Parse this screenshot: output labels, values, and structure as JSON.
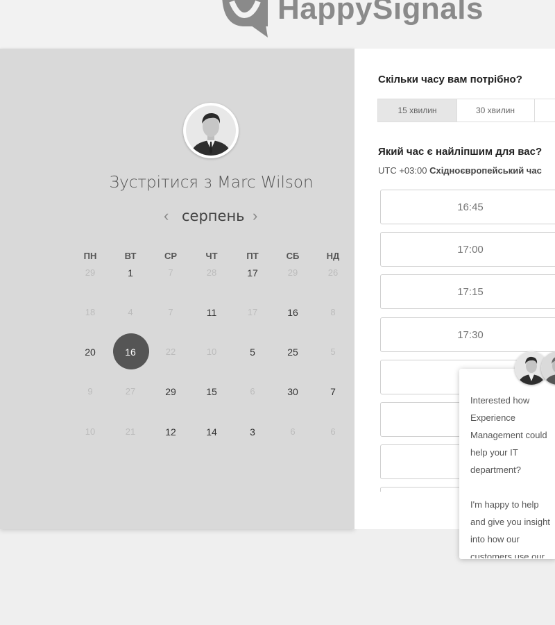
{
  "header": {
    "logo_text": "HappySignals"
  },
  "calendar": {
    "title": "Зустрітися з Marc Wilson",
    "month": "серпень",
    "weekdays": [
      "ПН",
      "ВТ",
      "СР",
      "ЧТ",
      "ПТ",
      "СБ",
      "НД"
    ],
    "weeks": [
      [
        "29",
        "1",
        "7",
        "28",
        "17",
        "29",
        "26"
      ],
      [
        "18",
        "4",
        "7",
        "11",
        "17",
        "16",
        "8"
      ],
      [
        "20",
        "16",
        "22",
        "10",
        "5",
        "25",
        "5"
      ],
      [
        "9",
        "27",
        "29",
        "15",
        "6",
        "30",
        "7"
      ],
      [
        "10",
        "21",
        "12",
        "14",
        "3",
        "6",
        "6"
      ]
    ],
    "available": [
      [
        false,
        true,
        false,
        false,
        true,
        false,
        false
      ],
      [
        false,
        false,
        false,
        true,
        false,
        true,
        false
      ],
      [
        true,
        true,
        false,
        false,
        true,
        true,
        false
      ],
      [
        false,
        false,
        true,
        true,
        false,
        true,
        true
      ],
      [
        false,
        false,
        true,
        true,
        true,
        false,
        false
      ]
    ],
    "selected_day": "16"
  },
  "booking": {
    "duration_question": "Скільки часу вам потрібно?",
    "durations": [
      "15 хвилин",
      "30 хвилин",
      ""
    ],
    "time_question": "Який час є найліпшим для вас?",
    "tz_offset": "UTC +03:00",
    "tz_name": "Східноєвропейський час",
    "slots": [
      "16:45",
      "17:00",
      "17:15",
      "17:30",
      "",
      "",
      ""
    ]
  },
  "chat": {
    "message": "Interested how Experience Management could help your IT department?\n\nI'm happy to help and give you insight into how our customers use our platform to drive improvement in IT experience and productivity."
  }
}
